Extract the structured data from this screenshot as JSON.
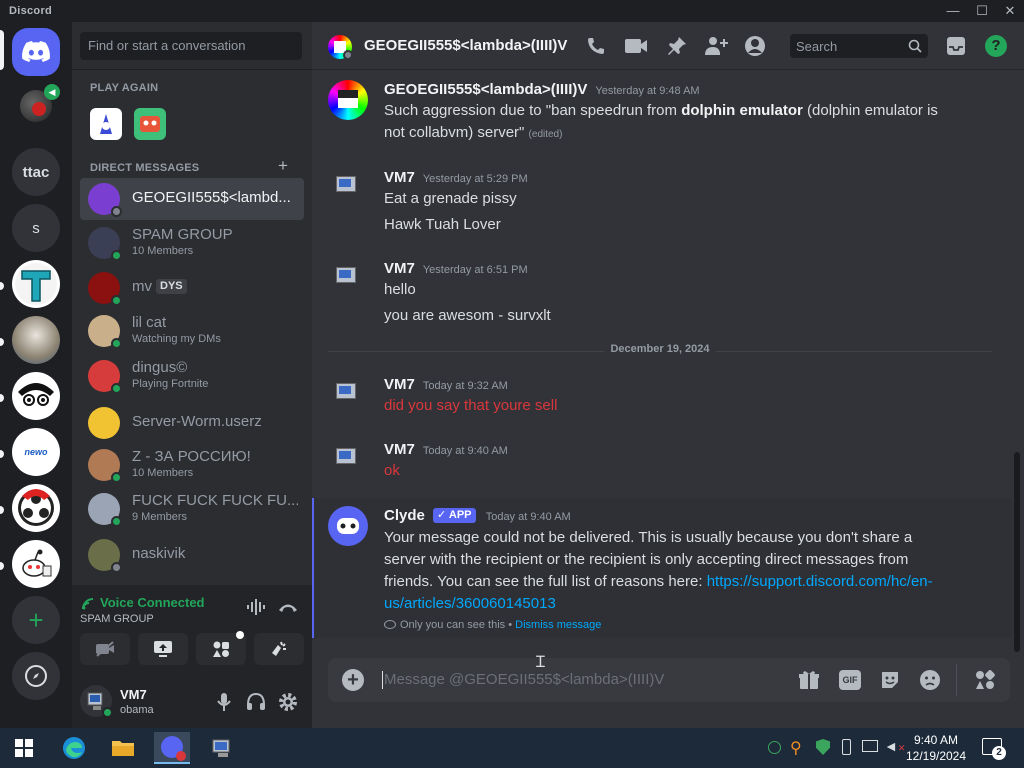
{
  "window": {
    "brand": "Discord",
    "minimize": "—",
    "maximize": "☐",
    "close": "✕"
  },
  "servers": [
    {
      "label": "",
      "kind": "home"
    },
    {
      "label": "",
      "kind": "voice-avatar"
    },
    {
      "label": "ttac",
      "kind": "text"
    },
    {
      "label": "s",
      "kind": "text"
    },
    {
      "label": "",
      "kind": "img-t"
    },
    {
      "label": "",
      "kind": "img-cat"
    },
    {
      "label": "",
      "kind": "img-face"
    },
    {
      "label": "newo",
      "kind": "img-newo"
    },
    {
      "label": "",
      "kind": "img-obs"
    },
    {
      "label": "",
      "kind": "img-reddit"
    },
    {
      "label": "+",
      "kind": "add"
    },
    {
      "label": "",
      "kind": "explore"
    }
  ],
  "dm_column": {
    "search_placeholder": "Find or start a conversation",
    "play_again": "PLAY AGAIN",
    "direct_messages": "DIRECT MESSAGES",
    "add_dm": "+",
    "dms": [
      {
        "name": "GEOEGII555$<lambd...",
        "sub": "",
        "status": "offline",
        "selected": true,
        "color": "#7a3fd0"
      },
      {
        "name": "SPAM GROUP",
        "sub": "10 Members",
        "status": "online",
        "selected": false,
        "color": "#3a3f55"
      },
      {
        "name": "mv",
        "sub": "",
        "badge": "DYS",
        "status": "online",
        "selected": false,
        "color": "#8b1010"
      },
      {
        "name": "lil cat",
        "sub": "Watching my DMs",
        "status": "online",
        "selected": false,
        "color": "#c9b08a"
      },
      {
        "name": "dingus©",
        "sub": "Playing Fortnite",
        "status": "online",
        "selected": false,
        "color": "#d73c3c"
      },
      {
        "name": "Server-Worm.userz",
        "sub": "",
        "status": "none",
        "selected": false,
        "color": "#f1c232"
      },
      {
        "name": "Z - ЗА РОССИЮ!",
        "sub": "10 Members",
        "status": "online",
        "selected": false,
        "color": "#b07a55"
      },
      {
        "name": "FUCK FUCK FUCK FU...",
        "sub": "9 Members",
        "status": "online",
        "selected": false,
        "color": "#9aa4b5"
      },
      {
        "name": "naskivik",
        "sub": "",
        "status": "offline",
        "selected": false,
        "color": "#6a6f4a"
      }
    ],
    "voice": {
      "status": "Voice Connected",
      "channel": "SPAM GROUP"
    },
    "user": {
      "name": "VM7",
      "tag": "obama"
    }
  },
  "chat": {
    "header_title": "GEOEGII555$<lambda>(IIII)V",
    "search_placeholder": "Search",
    "messages": [
      {
        "author": "GEOEGII555$<lambda>(IIII)V",
        "time": "Yesterday at 9:48 AM",
        "line1_pre": "Such aggression due to \"ban speedrun from ",
        "line1_bold": "dolphin emulator",
        "line1_post": " (dolphin emulator is",
        "line2": "not collabvm) server\"",
        "edited": "(edited)"
      },
      {
        "author": "VM7",
        "time": "Yesterday at 5:29 PM",
        "line1": "Eat a grenade pissy",
        "line2": "Hawk Tuah Lover"
      },
      {
        "author": "VM7",
        "time": "Yesterday at 6:51 PM",
        "line1": "hello",
        "line2": "you are awesom - survxlt"
      },
      {
        "author": "VM7",
        "time": "Today at 9:32 AM",
        "line1": "did you say that youre sell"
      },
      {
        "author": "VM7",
        "time": "Today at 9:40 AM",
        "line1": "ok"
      }
    ],
    "date_divider": "December 19, 2024",
    "clyde": {
      "author": "Clyde",
      "badge": "APP",
      "time": "Today at 9:40 AM",
      "line1": "Your message could not be delivered. This is usually because you don't share a",
      "line2": "server with the recipient or the recipient is only accepting direct messages from",
      "line3_pre": "friends. You can see the full list of reasons here: ",
      "line3_link": "https://support.discord.com/hc/en-",
      "line4_link": "us/articles/360060145013",
      "only_you": "Only you can see this",
      "sep": " • ",
      "dismiss": "Dismiss message"
    },
    "composer_placeholder": "Message @GEOEGII555$<lambda>(IIII)V",
    "gif_label": "GIF"
  },
  "taskbar": {
    "time": "9:40 AM",
    "date": "12/19/2024",
    "notif_count": "2"
  },
  "colors": {
    "blurple": "#5865f2",
    "green": "#23a55a",
    "link": "#00a8fc",
    "red": "#da373c"
  }
}
